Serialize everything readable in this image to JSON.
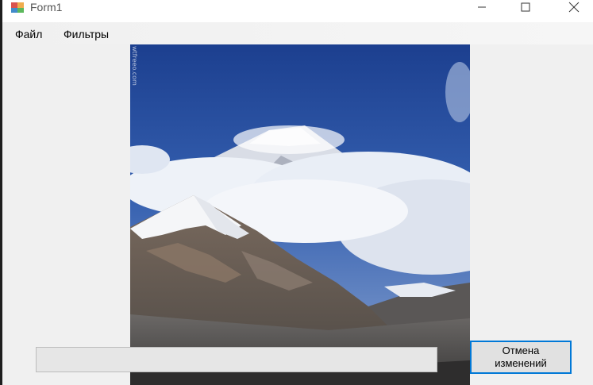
{
  "window": {
    "title": "Form1",
    "controls": [
      "minimize-icon",
      "maximize-icon",
      "close-icon"
    ]
  },
  "menu": {
    "items": [
      {
        "label": "Файл"
      },
      {
        "label": "Фильтры"
      }
    ]
  },
  "picture": {
    "watermark": "wtfreeo.com"
  },
  "progress": {
    "value": 0
  },
  "buttons": {
    "undo_line1": "Отмена",
    "undo_line2": "изменений"
  },
  "colors": {
    "accent": "#0078d7",
    "window_bg": "#f0f0f0",
    "progress_fill": "#06b025"
  }
}
